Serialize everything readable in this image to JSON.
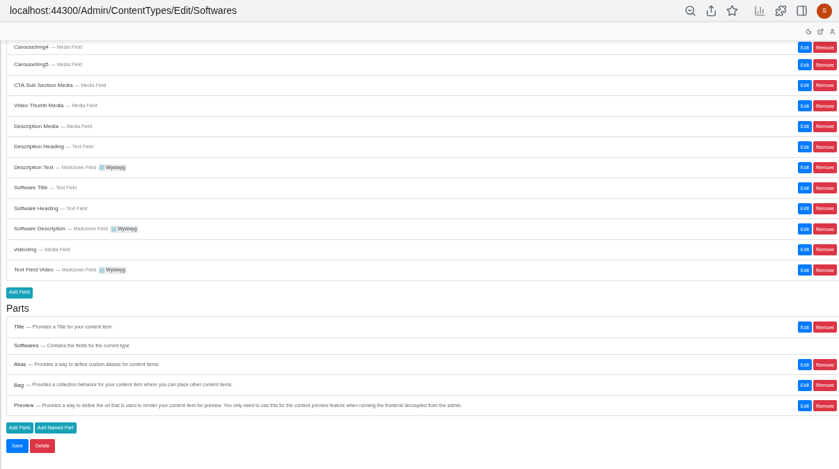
{
  "browser": {
    "url": "localhost:44300/Admin/ContentTypes/Edit/Softwares",
    "avatar": "S"
  },
  "fields": [
    {
      "name": "CarouselImg4",
      "type": "— Media Field",
      "buttons": [
        {
          "label": "Edit",
          "kind": "primary"
        },
        {
          "label": "Remove",
          "kind": "danger"
        }
      ]
    },
    {
      "name": "CarouselImg5",
      "type": "— Media Field",
      "buttons": [
        {
          "label": "Edit",
          "kind": "primary"
        },
        {
          "label": "Remove",
          "kind": "danger"
        }
      ]
    },
    {
      "name": "CTA Sub Section Media",
      "type": "— Media Field",
      "buttons": [
        {
          "label": "Edit",
          "kind": "primary"
        },
        {
          "label": "Remove",
          "kind": "danger"
        }
      ]
    },
    {
      "name": "Video Thumb Media",
      "type": "— Media Field",
      "buttons": [
        {
          "label": "Edit",
          "kind": "primary"
        },
        {
          "label": "Remove",
          "kind": "danger"
        }
      ]
    },
    {
      "name": "Description Media",
      "type": "— Media Field",
      "buttons": [
        {
          "label": "Edit",
          "kind": "primary"
        },
        {
          "label": "Remove",
          "kind": "danger"
        }
      ]
    },
    {
      "name": "Description Heading",
      "type": "— Text Field",
      "buttons": [
        {
          "label": "Edit",
          "kind": "primary"
        },
        {
          "label": "Remove",
          "kind": "danger"
        }
      ]
    },
    {
      "name": "Description Text",
      "type": "— Markdown Field",
      "badge": "Wysiwyg",
      "buttons": [
        {
          "label": "Edit",
          "kind": "primary"
        },
        {
          "label": "Remove",
          "kind": "danger"
        }
      ]
    },
    {
      "name": "Software Title",
      "type": "— Text Field",
      "buttons": [
        {
          "label": "Edit",
          "kind": "primary"
        },
        {
          "label": "Remove",
          "kind": "danger"
        }
      ]
    },
    {
      "name": "Software Heading",
      "type": "— Text Field",
      "buttons": [
        {
          "label": "Edit",
          "kind": "primary"
        },
        {
          "label": "Remove",
          "kind": "danger"
        }
      ]
    },
    {
      "name": "Software Description",
      "type": "— Markdown Field",
      "badge": "Wysiwyg",
      "buttons": [
        {
          "label": "Edit",
          "kind": "primary"
        },
        {
          "label": "Remove",
          "kind": "danger"
        }
      ]
    },
    {
      "name": "videoImg",
      "type": "— Media Field",
      "buttons": [
        {
          "label": "Edit",
          "kind": "primary"
        },
        {
          "label": "Remove",
          "kind": "danger"
        }
      ]
    },
    {
      "name": "Text Field Video",
      "type": "— Markdown Field",
      "badge": "Wysiwyg",
      "buttons": [
        {
          "label": "Edit",
          "kind": "primary"
        },
        {
          "label": "Remove",
          "kind": "danger"
        }
      ]
    }
  ],
  "add_field_button": "Add Field",
  "parts_heading": "Parts",
  "parts": [
    {
      "name": "Title",
      "description": "— Provides a Title for your content item.",
      "buttons": [
        {
          "label": "Edit",
          "kind": "primary"
        },
        {
          "label": "Remove",
          "kind": "danger"
        }
      ]
    },
    {
      "name": "Softwares",
      "description": "— Contains the fields for the current type"
    },
    {
      "name": "Alias",
      "description": "— Provides a way to define custom aliases for content items.",
      "buttons": [
        {
          "label": "Edit",
          "kind": "primary"
        },
        {
          "label": "Remove",
          "kind": "danger"
        }
      ]
    },
    {
      "name": "Bag",
      "description": "— Provides a collection behavior for your content item where you can place other content items.",
      "buttons": [
        {
          "label": "Edit",
          "kind": "primary"
        },
        {
          "label": "Remove",
          "kind": "danger"
        }
      ]
    },
    {
      "name": "Preview",
      "description": "— Provides a way to define the url that is used to render your content item for preview. You only need to use this for the content preview feature when running the frontend decoupled from the admin.",
      "buttons": [
        {
          "label": "Edit",
          "kind": "primary"
        },
        {
          "label": "Remove",
          "kind": "danger"
        }
      ]
    }
  ],
  "part_buttons": [
    "Add Parts",
    "Add Named Part"
  ],
  "form_buttons": [
    {
      "label": "Save",
      "kind": "primary"
    },
    {
      "label": "Delete",
      "kind": "danger"
    }
  ]
}
